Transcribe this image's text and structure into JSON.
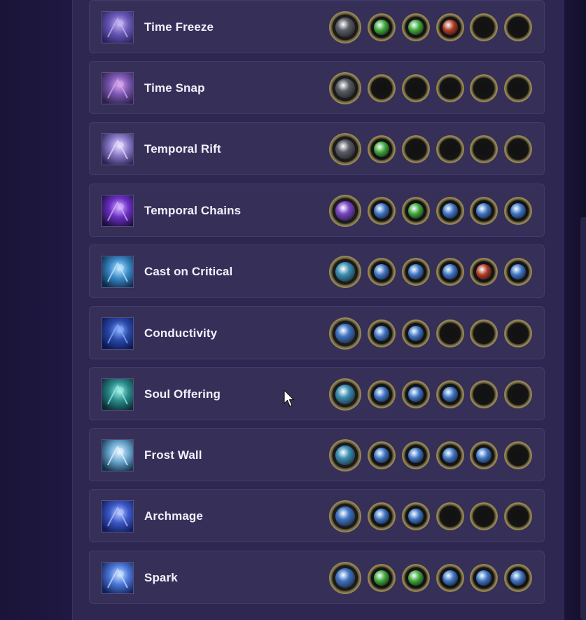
{
  "gems": [
    {
      "name": "Time Freeze",
      "icon": "time-freeze-icon",
      "main": "grey",
      "supports": [
        "green",
        "green",
        "red",
        "empty",
        "empty"
      ]
    },
    {
      "name": "Time Snap",
      "icon": "time-snap-icon",
      "main": "grey",
      "supports": [
        "empty",
        "empty",
        "empty",
        "empty",
        "empty"
      ]
    },
    {
      "name": "Temporal Rift",
      "icon": "temporal-rift-icon",
      "main": "grey",
      "supports": [
        "green",
        "empty",
        "empty",
        "empty",
        "empty"
      ]
    },
    {
      "name": "Temporal Chains",
      "icon": "temporal-chains-icon",
      "main": "purple",
      "supports": [
        "blue",
        "green",
        "blue",
        "blue",
        "blue"
      ]
    },
    {
      "name": "Cast on Critical",
      "icon": "cast-on-critical-icon",
      "main": "teal",
      "supports": [
        "blue",
        "blue",
        "blue",
        "red",
        "blue"
      ]
    },
    {
      "name": "Conductivity",
      "icon": "conductivity-icon",
      "main": "blue",
      "supports": [
        "blue",
        "blue",
        "empty",
        "empty",
        "empty"
      ]
    },
    {
      "name": "Soul Offering",
      "icon": "soul-offering-icon",
      "main": "teal",
      "supports": [
        "blue",
        "blue",
        "blue",
        "empty",
        "empty"
      ]
    },
    {
      "name": "Frost Wall",
      "icon": "frost-wall-icon",
      "main": "teal",
      "supports": [
        "blue",
        "blue",
        "blue",
        "blue",
        "empty"
      ]
    },
    {
      "name": "Archmage",
      "icon": "archmage-icon",
      "main": "blue",
      "supports": [
        "blue",
        "blue",
        "empty",
        "empty",
        "empty"
      ]
    },
    {
      "name": "Spark",
      "icon": "spark-icon",
      "main": "blue",
      "supports": [
        "green",
        "green",
        "blue",
        "blue",
        "blue"
      ]
    }
  ],
  "colors": {
    "grey": "#5a5d66",
    "purple": "#7a45c8",
    "teal": "#3b8fb4",
    "blue": "#3f74c4",
    "green": "#3fa63a",
    "red": "#b03a24",
    "empty": "#0e0e0e",
    "panel": "#2d2752",
    "row": "#363059"
  }
}
